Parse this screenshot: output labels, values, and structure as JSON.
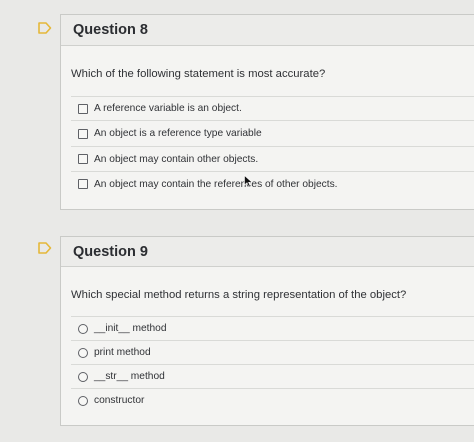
{
  "questions": [
    {
      "title": "Question 8",
      "prompt": "Which of the following statement is most accurate?",
      "answer_type": "checkbox",
      "answers": [
        "A reference variable is an object.",
        "An object is a reference type variable",
        "An object may contain other objects.",
        "An object may contain the references of other objects."
      ]
    },
    {
      "title": "Question 9",
      "prompt": "Which special method returns a string representation of the object?",
      "answer_type": "radio",
      "answers": [
        "__init__ method",
        "print method",
        "__str__ method",
        "constructor"
      ]
    }
  ],
  "colors": {
    "flag_stroke": "#e5b83a",
    "page_bg": "#e9e9e7",
    "card_bg": "#f4f4f2",
    "header_bg": "#ececea"
  },
  "icons": {
    "flag": "flag-outline-icon",
    "cursor": "mouse-pointer-icon"
  }
}
